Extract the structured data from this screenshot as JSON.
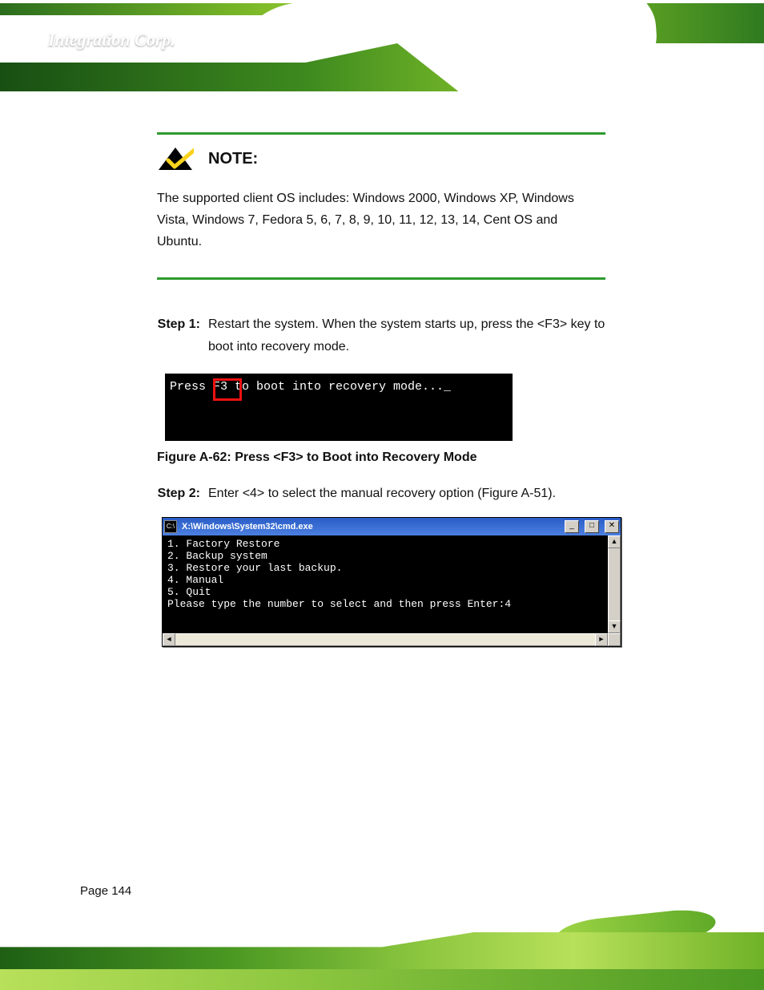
{
  "logo": {
    "brand": "Integration Corp.",
    "reg": "®"
  },
  "note": {
    "label": "NOTE:",
    "body": "The supported client OS includes: Windows 2000, Windows XP, Windows Vista, Windows 7, Fedora 5, 6, 7, 8, 9, 10, 11, 12, 13, 14, Cent OS and Ubuntu."
  },
  "step1": {
    "idx": "Step  1:",
    "text": "Restart the system. When the system starts up, press the <F3> key to boot into recovery mode."
  },
  "shot1": {
    "text": "Press F3 to boot into recovery mode..._"
  },
  "caption1": {
    "label_a": "Figure A-62:",
    "label_b": "Press <F3> to Boot into Recovery Mode"
  },
  "step2": {
    "idx": "Step  2:",
    "text": "Enter <4> to select the manual recovery option (Figure A-51)."
  },
  "cmd": {
    "title": "X:\\Windows\\System32\\cmd.exe",
    "btn_min": "_",
    "btn_max": "□",
    "btn_close": "✕",
    "body": "1. Factory Restore\n2. Backup system\n3. Restore your last backup.\n4. Manual\n5. Quit\nPlease type the number to select and then press Enter:4",
    "sb_up": "▲",
    "sb_down": "▼",
    "sb_left": "◄",
    "sb_right": "►"
  },
  "page_number": "Page 144"
}
